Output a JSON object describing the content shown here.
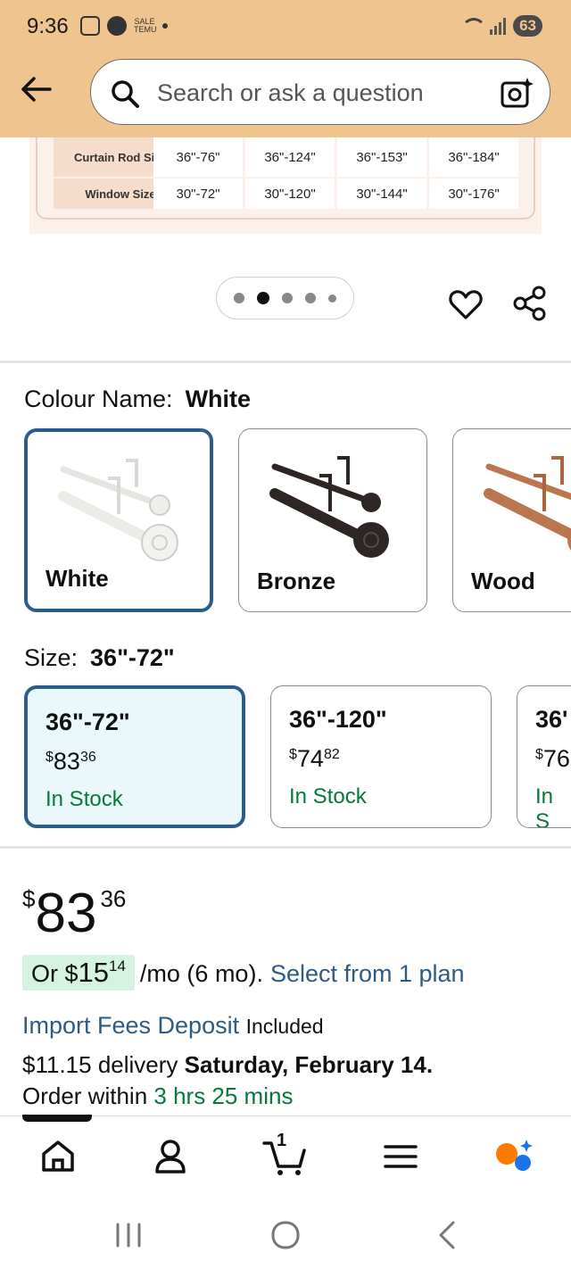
{
  "status_bar": {
    "time": "9:36",
    "temu_label": "SALE TEMU",
    "battery": "63"
  },
  "search": {
    "placeholder": "Search or ask a question"
  },
  "size_chart": {
    "row_labels": [
      "Curtain Rod Size",
      "Window Size"
    ],
    "curtain_rod_sizes": [
      "36\"-76\"",
      "36\"-124\"",
      "36\"-153\"",
      "36\"-184\""
    ],
    "window_sizes": [
      "30\"-72\"",
      "30\"-120\"",
      "30\"-144\"",
      "30\"-176\""
    ]
  },
  "carousel": {
    "dot_count": 5,
    "active_index": 1
  },
  "colour": {
    "label": "Colour Name:",
    "selected": "White",
    "options": [
      {
        "name": "White",
        "color": "#f2f2ee",
        "selected": true
      },
      {
        "name": "Bronze",
        "color": "#2e2624",
        "selected": false
      },
      {
        "name": "Wood",
        "color": "#b9764f",
        "selected": false
      }
    ]
  },
  "size": {
    "label": "Size:",
    "selected": "36\"-72\"",
    "options": [
      {
        "name": "36\"-72\"",
        "price_whole": "83",
        "price_cents": "36",
        "stock": "In Stock",
        "selected": true
      },
      {
        "name": "36\"-120\"",
        "price_whole": "74",
        "price_cents": "82",
        "stock": "In Stock",
        "selected": false
      },
      {
        "name": "36'",
        "price_whole": "76",
        "price_cents": "",
        "stock": "In S",
        "selected": false
      }
    ]
  },
  "price": {
    "currency": "$",
    "whole": "83",
    "cents": "36"
  },
  "monthly": {
    "prefix": "Or $",
    "amount_whole": "15",
    "amount_cents": "14",
    "suffix": "/mo (6 mo).",
    "link": "Select from 1 plan"
  },
  "fees": {
    "link": "Import Fees Deposit",
    "status": "Included"
  },
  "delivery": {
    "text": "$11.15 delivery",
    "date": "Saturday, February 14."
  },
  "order_within": {
    "prefix": "Order within",
    "time_left": "3 hrs 25 mins"
  },
  "bottom_nav": {
    "cart_count": "1",
    "items": [
      "home-icon",
      "account-icon",
      "cart-icon",
      "menu-icon",
      "rufus-icon"
    ]
  },
  "colors": {
    "header_bg": "#f0c48e",
    "selected_border": "#2b5d8c",
    "link": "#2f5a82",
    "in_stock": "#077839",
    "monthly_chip": "#d6f2e0"
  }
}
